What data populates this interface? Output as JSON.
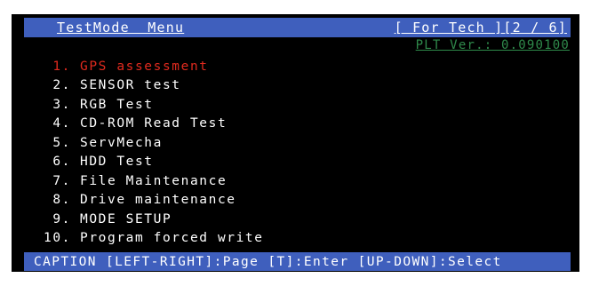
{
  "header": {
    "title": "TestMode  Menu",
    "tech": "[ For Tech ][2 / 6]"
  },
  "version": "PLT Ver.: 0.090100",
  "menu": {
    "items": [
      {
        "num": "1.",
        "label": "GPS assessment"
      },
      {
        "num": "2.",
        "label": "SENSOR test"
      },
      {
        "num": "3.",
        "label": "RGB Test"
      },
      {
        "num": "4.",
        "label": "CD-ROM Read Test"
      },
      {
        "num": "5.",
        "label": "ServMecha"
      },
      {
        "num": "6.",
        "label": "HDD Test"
      },
      {
        "num": "7.",
        "label": "File Maintenance"
      },
      {
        "num": "8.",
        "label": "Drive maintenance"
      },
      {
        "num": "9.",
        "label": "MODE SETUP"
      },
      {
        "num": "10.",
        "label": "Program forced write"
      }
    ]
  },
  "footer": {
    "caption": "CAPTION [LEFT-RIGHT]:Page [T]:Enter [UP-DOWN]:Select"
  },
  "colors": {
    "background": "#000000",
    "bar": "#3f5fbd",
    "selected": "#e02a1e",
    "version": "#2f8a4b",
    "text": "#ffffff"
  }
}
